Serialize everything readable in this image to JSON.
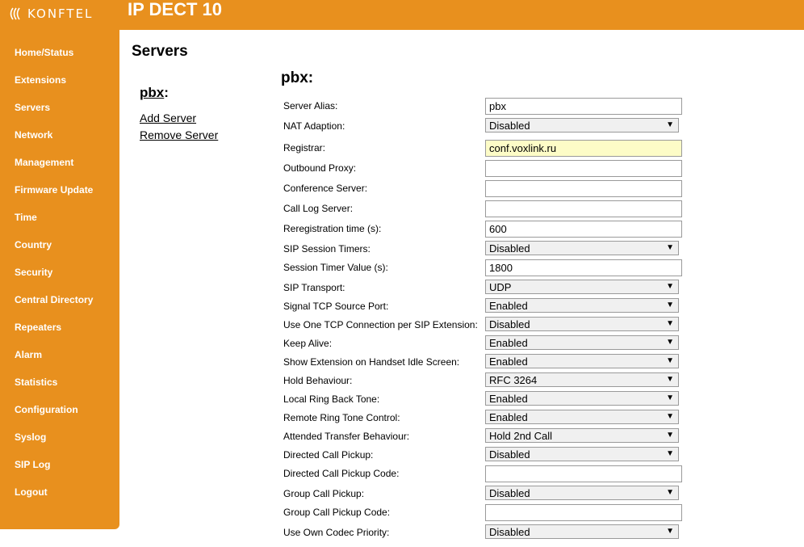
{
  "header": {
    "logo_text": "KONFTEL",
    "title": "IP DECT 10"
  },
  "sidebar": {
    "items": [
      {
        "label": "Home/Status"
      },
      {
        "label": "Extensions"
      },
      {
        "label": "Servers"
      },
      {
        "label": "Network"
      },
      {
        "label": "Management"
      },
      {
        "label": "Firmware Update"
      },
      {
        "label": "Time"
      },
      {
        "label": "Country"
      },
      {
        "label": "Security"
      },
      {
        "label": "Central Directory"
      },
      {
        "label": "Repeaters"
      },
      {
        "label": "Alarm"
      },
      {
        "label": "Statistics"
      },
      {
        "label": "Configuration"
      },
      {
        "label": "Syslog"
      },
      {
        "label": "SIP Log"
      },
      {
        "label": "Logout"
      }
    ]
  },
  "page": {
    "title": "Servers"
  },
  "server_list": {
    "current": "pbx",
    "colon": ":",
    "add_label": "Add Server",
    "remove_label": "Remove Server"
  },
  "form": {
    "title": "pbx:",
    "fields": [
      {
        "label": "Server Alias:",
        "type": "text",
        "value": "pbx"
      },
      {
        "label": "NAT Adaption:",
        "type": "select",
        "value": "Disabled"
      },
      {
        "label": "Registrar:",
        "type": "text",
        "value": "conf.voxlink.ru"
      },
      {
        "label": "Outbound Proxy:",
        "type": "text",
        "value": ""
      },
      {
        "label": "Conference Server:",
        "type": "text",
        "value": ""
      },
      {
        "label": "Call Log Server:",
        "type": "text",
        "value": ""
      },
      {
        "label": "Reregistration time (s):",
        "type": "text",
        "value": "600"
      },
      {
        "label": "SIP Session Timers:",
        "type": "select",
        "value": "Disabled"
      },
      {
        "label": "Session Timer Value (s):",
        "type": "text",
        "value": "1800"
      },
      {
        "label": "SIP Transport:",
        "type": "select",
        "value": "UDP"
      },
      {
        "label": "Signal TCP Source Port:",
        "type": "select",
        "value": "Enabled"
      },
      {
        "label": "Use One TCP Connection per SIP Extension:",
        "type": "select",
        "value": "Disabled"
      },
      {
        "label": "Keep Alive:",
        "type": "select",
        "value": "Enabled"
      },
      {
        "label": "Show Extension on Handset Idle Screen:",
        "type": "select",
        "value": "Enabled"
      },
      {
        "label": "Hold Behaviour:",
        "type": "select",
        "value": "RFC 3264"
      },
      {
        "label": "Local Ring Back Tone:",
        "type": "select",
        "value": "Enabled"
      },
      {
        "label": "Remote Ring Tone Control:",
        "type": "select",
        "value": "Enabled"
      },
      {
        "label": "Attended Transfer Behaviour:",
        "type": "select",
        "value": "Hold 2nd Call"
      },
      {
        "label": "Directed Call Pickup:",
        "type": "select",
        "value": "Disabled"
      },
      {
        "label": "Directed Call Pickup Code:",
        "type": "text",
        "value": ""
      },
      {
        "label": "Group Call Pickup:",
        "type": "select",
        "value": "Disabled"
      },
      {
        "label": "Group Call Pickup Code:",
        "type": "text",
        "value": ""
      },
      {
        "label": "Use Own Codec Priority:",
        "type": "select",
        "value": "Disabled"
      }
    ]
  },
  "icons": {
    "dropdown": "dropdown-arrow-icon",
    "logo": "konftel-waves-logo-icon"
  },
  "colors": {
    "accent": "#e8901e",
    "highlight_field": "#fdfcc7"
  }
}
